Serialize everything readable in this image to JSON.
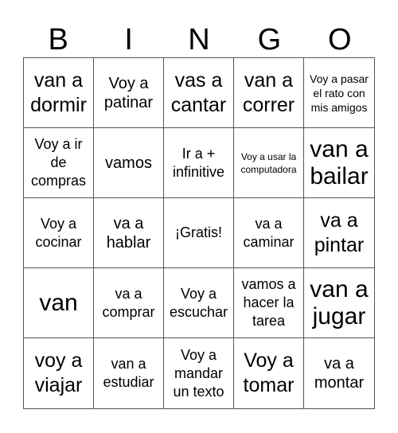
{
  "header": {
    "letters": [
      "B",
      "I",
      "N",
      "G",
      "O"
    ]
  },
  "grid": {
    "rows": [
      [
        {
          "text": "van a dormir",
          "size": "fs-l"
        },
        {
          "text": "Voy a patinar",
          "size": "fs-m"
        },
        {
          "text": "vas a cantar",
          "size": "fs-l"
        },
        {
          "text": "van a correr",
          "size": "fs-l"
        },
        {
          "text": "Voy a pasar el rato con mis amigos",
          "size": "fs-xs"
        }
      ],
      [
        {
          "text": "Voy a ir de compras",
          "size": "fs-s"
        },
        {
          "text": "vamos",
          "size": "fs-m"
        },
        {
          "text": "Ir a + infinitive",
          "size": "fs-s"
        },
        {
          "text": "Voy a usar la computadora",
          "size": "fs-xxs"
        },
        {
          "text": "van a bailar",
          "size": "fs-xl"
        }
      ],
      [
        {
          "text": "Voy a cocinar",
          "size": "fs-s"
        },
        {
          "text": "va a hablar",
          "size": "fs-m"
        },
        {
          "text": "¡Gratis!",
          "size": "fs-s"
        },
        {
          "text": "va a caminar",
          "size": "fs-s"
        },
        {
          "text": "va a pintar",
          "size": "fs-l"
        }
      ],
      [
        {
          "text": "van",
          "size": "fs-xl"
        },
        {
          "text": "va a comprar",
          "size": "fs-s"
        },
        {
          "text": "Voy a escuchar",
          "size": "fs-s"
        },
        {
          "text": "vamos a hacer la tarea",
          "size": "fs-s"
        },
        {
          "text": "van a jugar",
          "size": "fs-xl"
        }
      ],
      [
        {
          "text": "voy a viajar",
          "size": "fs-l"
        },
        {
          "text": "van a estudiar",
          "size": "fs-s"
        },
        {
          "text": "Voy a mandar un texto",
          "size": "fs-s"
        },
        {
          "text": "Voy a tomar",
          "size": "fs-l"
        },
        {
          "text": "va a montar",
          "size": "fs-m"
        }
      ]
    ]
  }
}
